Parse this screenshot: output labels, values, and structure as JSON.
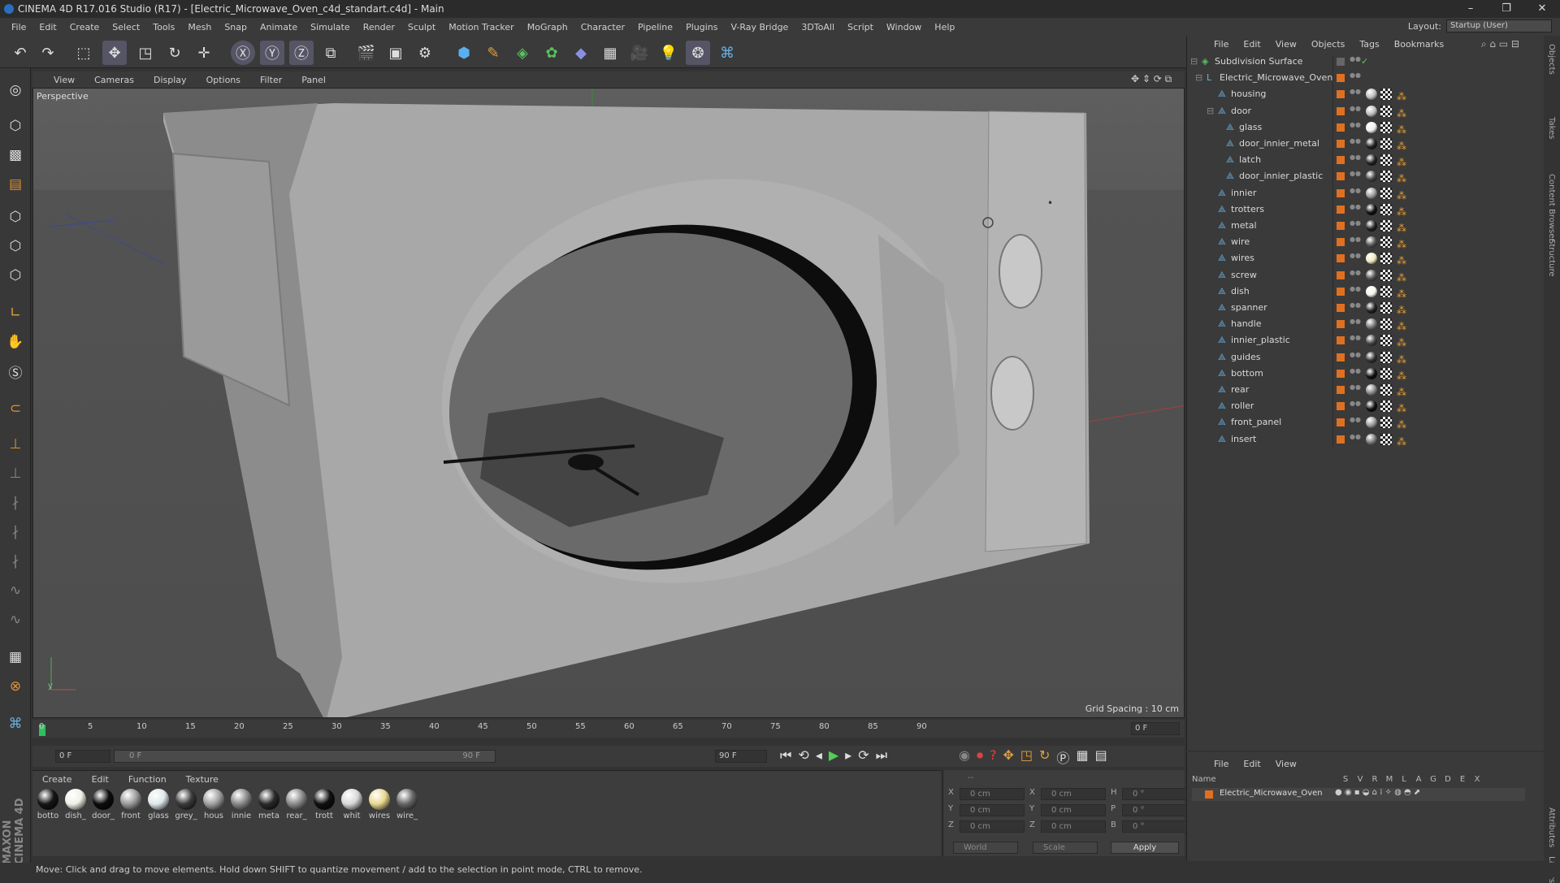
{
  "window": {
    "title": "CINEMA 4D R17.016 Studio (R17) - [Electric_Microwave_Oven_c4d_standart.c4d] - Main",
    "controls": [
      "–",
      "❐",
      "✕"
    ]
  },
  "menu": [
    "File",
    "Edit",
    "Create",
    "Select",
    "Tools",
    "Mesh",
    "Snap",
    "Animate",
    "Simulate",
    "Render",
    "Sculpt",
    "Motion Tracker",
    "MoGraph",
    "Character",
    "Pipeline",
    "Plugins",
    "V-Ray Bridge",
    "3DToAll",
    "Script",
    "Window",
    "Help"
  ],
  "layout": {
    "label": "Layout:",
    "value": "Startup (User)"
  },
  "viewport": {
    "menu": [
      "View",
      "Cameras",
      "Display",
      "Options",
      "Filter",
      "Panel"
    ],
    "label": "Perspective",
    "grid_spacing": "Grid Spacing : 10 cm"
  },
  "timeline": {
    "ticks": [
      "0",
      "5",
      "10",
      "15",
      "20",
      "25",
      "30",
      "35",
      "40",
      "45",
      "50",
      "55",
      "60",
      "65",
      "70",
      "75",
      "80",
      "85",
      "90"
    ],
    "current": "0 F",
    "start": "0 F",
    "slider_start": "0 F",
    "slider_end": "90 F",
    "end": "90 F"
  },
  "materials": {
    "menu": [
      "Create",
      "Edit",
      "Function",
      "Texture"
    ],
    "items": [
      {
        "name": "botto",
        "color": "#151515"
      },
      {
        "name": "dish_",
        "color": "#f0f0e8"
      },
      {
        "name": "door_",
        "color": "#0c0c0c"
      },
      {
        "name": "front",
        "color": "#9a9a9a"
      },
      {
        "name": "glass",
        "color": "#dfe8ea"
      },
      {
        "name": "grey_",
        "color": "#3a3a3a"
      },
      {
        "name": "hous",
        "color": "#a0a0a0"
      },
      {
        "name": "innie",
        "color": "#888888"
      },
      {
        "name": "meta",
        "color": "#2a2a2a"
      },
      {
        "name": "rear_",
        "color": "#8a8a8a"
      },
      {
        "name": "trott",
        "color": "#101010"
      },
      {
        "name": "whit",
        "color": "#d8d8d8"
      },
      {
        "name": "wires",
        "color": "#e8d890"
      },
      {
        "name": "wire_",
        "color": "#666666"
      }
    ]
  },
  "coords": {
    "rows": [
      [
        "X",
        "0 cm",
        "X",
        "0 cm",
        "H",
        "0 °"
      ],
      [
        "Y",
        "0 cm",
        "Y",
        "0 cm",
        "P",
        "0 °"
      ],
      [
        "Z",
        "0 cm",
        "Z",
        "0 cm",
        "B",
        "0 °"
      ]
    ],
    "world": "World",
    "scale": "Scale",
    "apply": "Apply",
    "dashes": "--"
  },
  "objects": {
    "menu": [
      "File",
      "Edit",
      "View",
      "Objects",
      "Tags",
      "Bookmarks"
    ],
    "items": [
      {
        "name": "Subdivision Surface",
        "level": 0,
        "tag": "",
        "root": true
      },
      {
        "name": "Electric_Microwave_Oven",
        "level": 1,
        "tag": ""
      },
      {
        "name": "housing",
        "level": 2,
        "tag": "#bbbbbb"
      },
      {
        "name": "door",
        "level": 2,
        "tag": "#bbbbbb"
      },
      {
        "name": "glass",
        "level": 3,
        "tag": "#eeeeee"
      },
      {
        "name": "door_innier_metal",
        "level": 3,
        "tag": "#222222"
      },
      {
        "name": "latch",
        "level": 3,
        "tag": "#222222"
      },
      {
        "name": "door_innier_plastic",
        "level": 3,
        "tag": "#444444"
      },
      {
        "name": "innier",
        "level": 2,
        "tag": "#999999"
      },
      {
        "name": "trotters",
        "level": 2,
        "tag": "#111111"
      },
      {
        "name": "metal",
        "level": 2,
        "tag": "#222222"
      },
      {
        "name": "wire",
        "level": 2,
        "tag": "#555555"
      },
      {
        "name": "wires",
        "level": 2,
        "tag": "#f0e8c0"
      },
      {
        "name": "screw",
        "level": 2,
        "tag": "#555555"
      },
      {
        "name": "dish",
        "level": 2,
        "tag": "#f4f4ec"
      },
      {
        "name": "spanner",
        "level": 2,
        "tag": "#222222"
      },
      {
        "name": "handle",
        "level": 2,
        "tag": "#777777"
      },
      {
        "name": "innier_plastic",
        "level": 2,
        "tag": "#444444"
      },
      {
        "name": "guides",
        "level": 2,
        "tag": "#333333"
      },
      {
        "name": "bottom",
        "level": 2,
        "tag": "#111111"
      },
      {
        "name": "rear",
        "level": 2,
        "tag": "#888888"
      },
      {
        "name": "roller",
        "level": 2,
        "tag": "#111111"
      },
      {
        "name": "front_panel",
        "level": 2,
        "tag": "#999999"
      },
      {
        "name": "insert",
        "level": 2,
        "tag": "#777777"
      }
    ]
  },
  "attributes": {
    "menu": [
      "File",
      "Edit",
      "View"
    ],
    "columns": [
      "Name",
      "S",
      "V",
      "R",
      "M",
      "L",
      "A",
      "G",
      "D",
      "E",
      "X"
    ],
    "row": "Electric_Microwave_Oven"
  },
  "right_tabs": [
    "Objects",
    "Takes",
    "Content Browser",
    "Structure",
    "Attributes",
    "Layers"
  ],
  "status": "Move: Click and drag to move elements. Hold down SHIFT to quantize movement / add to the selection in point mode, CTRL to remove.",
  "brand": "MAXON CINEMA 4D"
}
